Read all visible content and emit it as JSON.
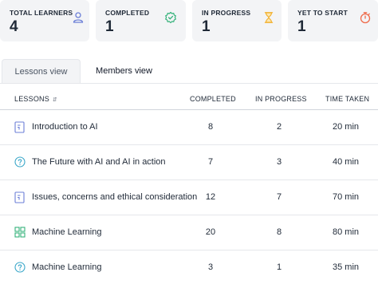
{
  "stats": [
    {
      "label": "TOTAL LEARNERS",
      "value": "4",
      "icon": "user-icon",
      "color": "#6b7fd7"
    },
    {
      "label": "COMPLETED",
      "value": "1",
      "icon": "gear-badge-icon",
      "color": "#34b27a"
    },
    {
      "label": "IN PROGRESS",
      "value": "1",
      "icon": "hourglass-icon",
      "color": "#f2b233"
    },
    {
      "label": "YET TO START",
      "value": "1",
      "icon": "timer-icon",
      "color": "#ef6b4a"
    }
  ],
  "tabs": {
    "lessons": "Lessons view",
    "members": "Members view"
  },
  "table": {
    "headers": {
      "lessons": "LESSONS",
      "completed": "COMPLETED",
      "in_progress": "IN PROGRESS",
      "time_taken": "TIME TAKEN"
    },
    "rows": [
      {
        "title": "Introduction to AI",
        "icon": "document-icon",
        "completed": "8",
        "in_progress": "2",
        "time": "20 min"
      },
      {
        "title": "The Future with AI and AI in action",
        "icon": "quiz-icon",
        "completed": "7",
        "in_progress": "3",
        "time": "40 min"
      },
      {
        "title": "Issues, concerns and ethical consideration",
        "icon": "document-icon",
        "completed": "12",
        "in_progress": "7",
        "time": "70 min"
      },
      {
        "title": "Machine Learning",
        "icon": "grid-icon",
        "completed": "20",
        "in_progress": "8",
        "time": "80 min"
      },
      {
        "title": "Machine Learning",
        "icon": "quiz-icon",
        "completed": "3",
        "in_progress": "1",
        "time": "35 min"
      }
    ]
  },
  "colors": {
    "accent": "#6b7fd7",
    "green": "#34b27a"
  }
}
